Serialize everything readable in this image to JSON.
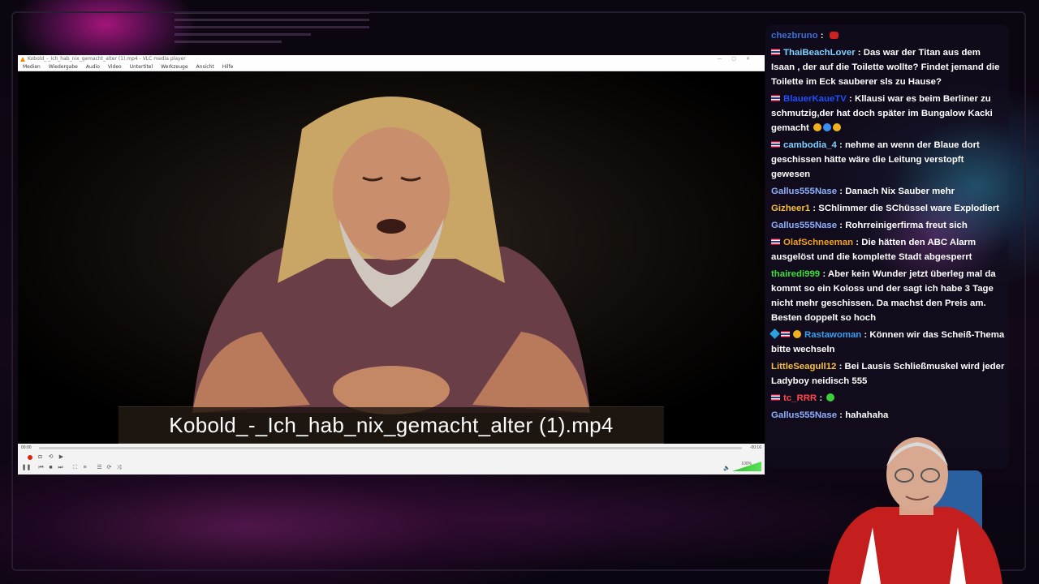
{
  "vlc": {
    "title": "Kobold_-_Ich_hab_nix_gemacht_alter (1).mp4 - VLC media player",
    "menu": [
      "Medien",
      "Wiedergabe",
      "Audio",
      "Video",
      "Untertitel",
      "Werkzeuge",
      "Ansicht",
      "Hilfe"
    ],
    "subtitle": "Kobold_-_Ich_hab_nix_gemacht_alter (1).mp4",
    "time_elapsed": "00:00",
    "time_remaining": "-00:16",
    "volume_label": "100%",
    "progress": 0.0
  },
  "chat": {
    "messages": [
      {
        "user": "chezbruno",
        "color": "#3a6fd8",
        "flag": false,
        "text": ""
      },
      {
        "user": "ThaiBeachLover",
        "color": "#7fd0ff",
        "flag": true,
        "text": "Das war der Titan aus dem Isaan , der auf die Toilette wollte? Findet jemand die Toilette im Eck sauberer sls zu Hause?"
      },
      {
        "user": "BlauerKaueTV",
        "color": "#1f4fff",
        "flag": true,
        "text": "Kllausi war es beim Berliner zu schmutzig,der hat doch später im Bungalow Kacki gemacht"
      },
      {
        "user": "cambodia_4",
        "color": "#7fd0ff",
        "flag": true,
        "text": "nehme an wenn der Blaue dort geschissen hätte wäre die Leitung verstopft gewesen"
      },
      {
        "user": "Gallus555Nase",
        "color": "#8fb0ff",
        "flag": false,
        "text": "Danach Nix Sauber mehr"
      },
      {
        "user": "Gizheer1",
        "color": "#f5c040",
        "flag": false,
        "text": "SChlimmer die SChüssel ware Explodiert"
      },
      {
        "user": "Gallus555Nase",
        "color": "#8fb0ff",
        "flag": false,
        "text": "Rohrreinigerfirma freut sich"
      },
      {
        "user": "OlafSchneeman",
        "color": "#f0a020",
        "flag": true,
        "text": "Die hätten den ABC Alarm ausgelöst und die komplette Stadt abgesperrt"
      },
      {
        "user": "thairedi999",
        "color": "#3ce03c",
        "flag": false,
        "text": "Aber kein Wunder jetzt überleg mal da kommt so ein Koloss und der sagt ich habe 3 Tage nicht mehr geschissen. Da machst den Preis am. Besten doppelt so hoch"
      },
      {
        "user": "Rastawoman",
        "color": "#3aa0f0",
        "flag": true,
        "text": "Können wir das Scheiß-Thema bitte wechseln"
      },
      {
        "user": "LittleSeagull12",
        "color": "#f5c040",
        "flag": false,
        "text": "Bei Lausis Schließmuskel wird jeder Ladyboy neidisch 555"
      },
      {
        "user": "tc_RRR",
        "color": "#ff4a4a",
        "flag": true,
        "text": ""
      },
      {
        "user": "Gallus555Nase",
        "color": "#8fb0ff",
        "flag": false,
        "text": "hahahaha"
      }
    ]
  }
}
